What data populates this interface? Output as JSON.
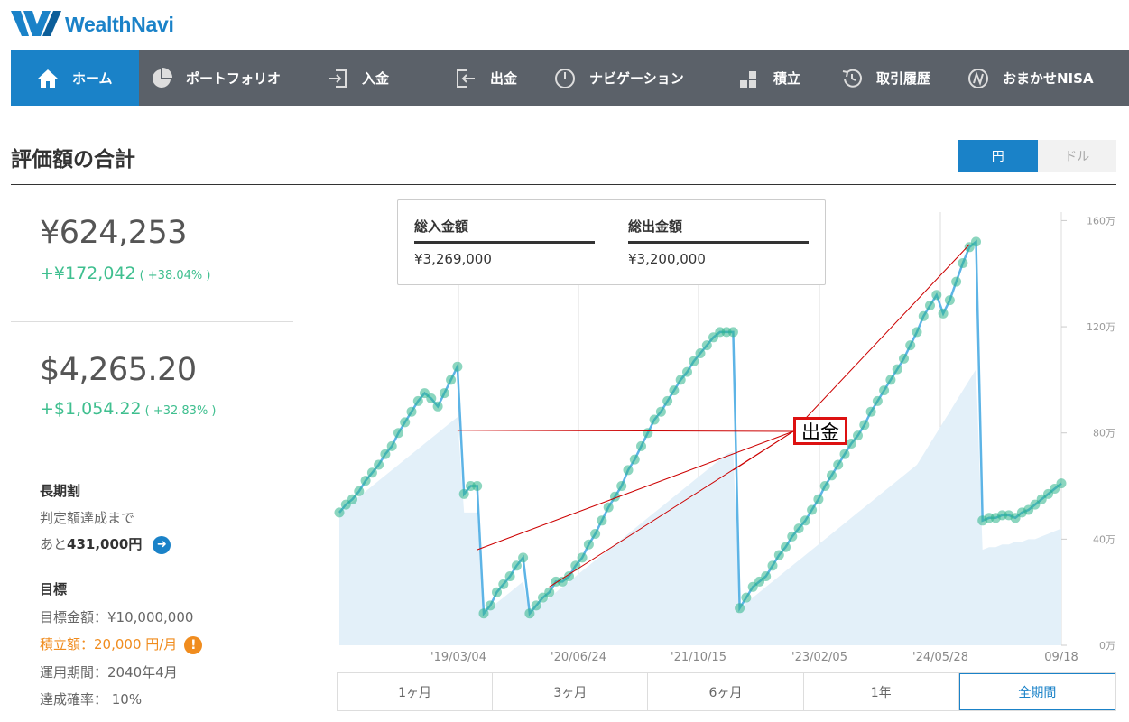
{
  "brand": {
    "name": "WealthNavi"
  },
  "nav": [
    {
      "label": "ホーム",
      "icon": "home-icon",
      "active": true
    },
    {
      "label": "ポートフォリオ",
      "icon": "pie-chart-icon"
    },
    {
      "label": "入金",
      "icon": "deposit-icon"
    },
    {
      "label": "出金",
      "icon": "withdraw-icon"
    },
    {
      "label": "ナビゲーション",
      "icon": "gauge-icon"
    },
    {
      "label": "積立",
      "icon": "blocks-icon"
    },
    {
      "label": "取引履歴",
      "icon": "history-icon"
    },
    {
      "label": "おまかせNISA",
      "icon": "nisa-icon"
    }
  ],
  "section": {
    "title": "評価額の合計"
  },
  "currency_toggle": {
    "yen": "円",
    "dollar": "ドル",
    "selected": "yen"
  },
  "summary": {
    "yen_total": "¥624,253",
    "yen_gain": "+¥172,042",
    "yen_gain_pct": "( +38.04% )",
    "usd_total": "$4,265.20",
    "usd_gain": "+$1,054.22",
    "usd_gain_pct": "( +32.83% )"
  },
  "long_term": {
    "title": "長期割",
    "line1": "判定額達成まで",
    "prefix": "あと",
    "amount": "431,000円"
  },
  "goal": {
    "title": "目標",
    "target": "目標金額：¥10,000,000",
    "monthly": "積立額：20,000 円/月",
    "period": "運用期間：2040年4月",
    "probability": "達成確率： 10%"
  },
  "totals_card": {
    "deposit_label": "総入金額",
    "deposit_value": "¥3,269,000",
    "withdraw_label": "総出金額",
    "withdraw_value": "¥3,200,000"
  },
  "annotation": {
    "label": "出金"
  },
  "periods": [
    "1ヶ月",
    "3ヶ月",
    "6ヶ月",
    "1年",
    "全期間"
  ],
  "period_selected": "全期間",
  "colors": {
    "accent": "#1a82c8",
    "gain": "#3fbf8f",
    "nav_bg": "#5b6169",
    "warning": "#f08c1e",
    "annotation": "#dd1111"
  },
  "chart_data": {
    "type": "area",
    "x_ticks": [
      "'19/03/04",
      "'20/06/24",
      "'21/10/15",
      "'23/02/05",
      "'24/05/28",
      "09/18"
    ],
    "y_ticks": [
      "0万",
      "40万",
      "80万",
      "120万",
      "160万"
    ],
    "ylim": [
      0,
      170
    ],
    "series": [
      {
        "values": [
          50,
          53,
          55,
          58,
          62,
          65,
          68,
          72,
          75,
          80,
          84,
          88,
          92,
          95,
          93,
          90,
          95,
          100,
          105,
          57,
          60,
          60,
          12,
          15,
          20,
          23,
          26,
          30,
          33,
          12,
          15,
          18,
          20,
          24,
          24,
          26,
          30,
          33,
          38,
          42,
          47,
          52,
          56,
          60,
          66,
          70,
          75,
          80,
          85,
          88,
          92,
          96,
          100,
          103,
          107,
          110,
          113,
          116,
          118,
          118,
          118,
          14,
          18,
          22,
          24,
          26,
          30,
          34,
          37,
          41,
          44,
          47,
          51,
          55,
          60,
          64,
          68,
          72,
          76,
          79,
          83,
          88,
          92,
          96,
          100,
          104,
          108,
          113,
          118,
          124,
          128,
          132,
          125,
          130,
          137,
          144,
          150,
          152,
          47,
          48,
          48,
          49,
          49,
          48,
          50,
          51,
          53,
          55,
          57,
          59,
          61
        ]
      },
      {
        "values": [
          50,
          52,
          54,
          56,
          58,
          60,
          62,
          64,
          66,
          68,
          70,
          72,
          74,
          76,
          78,
          80,
          82,
          84,
          86,
          50,
          50,
          50,
          12,
          14,
          16,
          18,
          20,
          22,
          24,
          12,
          14,
          16,
          18,
          20,
          22,
          24,
          26,
          28,
          30,
          32,
          34,
          36,
          38,
          40,
          42,
          44,
          46,
          48,
          50,
          52,
          54,
          56,
          58,
          60,
          62,
          64,
          66,
          68,
          70,
          72,
          73,
          14,
          16,
          18,
          20,
          22,
          24,
          26,
          28,
          30,
          32,
          34,
          36,
          38,
          40,
          42,
          44,
          46,
          48,
          50,
          52,
          54,
          56,
          58,
          60,
          62,
          64,
          66,
          68,
          72,
          76,
          80,
          84,
          88,
          92,
          96,
          100,
          104,
          36,
          37,
          37,
          38,
          38,
          39,
          39,
          40,
          40,
          41,
          42,
          43,
          44
        ]
      }
    ],
    "withdrawals": [
      {
        "marker_index": 18
      },
      {
        "marker_index": 21
      },
      {
        "marker_index": 32
      },
      {
        "marker_index": 60
      },
      {
        "marker_index": 96
      }
    ]
  }
}
